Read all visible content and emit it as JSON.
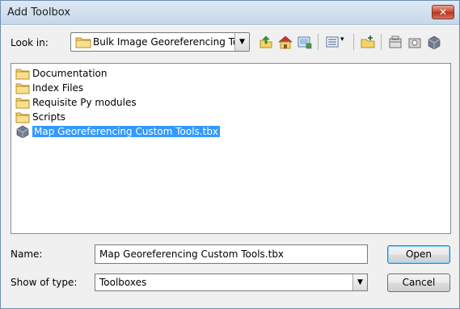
{
  "window": {
    "title": "Add Toolbox",
    "close_glyph": "✕"
  },
  "lookin": {
    "label": "Look in:",
    "value": "Bulk Image Georeferencing Tool",
    "dropdown_glyph": "▼"
  },
  "toolbar": {
    "icons": [
      "up-one-level-icon",
      "home-icon",
      "connect-folder-icon",
      "view-options-icon",
      "new-folder-icon",
      "new-toolbox-icon",
      "toolbox-catalog-icon",
      "toolbox-options-icon"
    ]
  },
  "files": [
    {
      "name": "Documentation",
      "type": "folder"
    },
    {
      "name": "Index Files",
      "type": "folder"
    },
    {
      "name": "Requisite Py modules",
      "type": "folder"
    },
    {
      "name": "Scripts",
      "type": "folder"
    },
    {
      "name": "Map Georeferencing Custom Tools.tbx",
      "type": "toolbox",
      "selected": true
    }
  ],
  "name_field": {
    "label": "Name:",
    "value": "Map Georeferencing Custom Tools.tbx"
  },
  "type_field": {
    "label": "Show of type:",
    "value": "Toolboxes",
    "dropdown_glyph": "▼"
  },
  "buttons": {
    "open": "Open",
    "cancel": "Cancel"
  },
  "colors": {
    "selection": "#3399ff",
    "folder": "#f5d36b"
  }
}
